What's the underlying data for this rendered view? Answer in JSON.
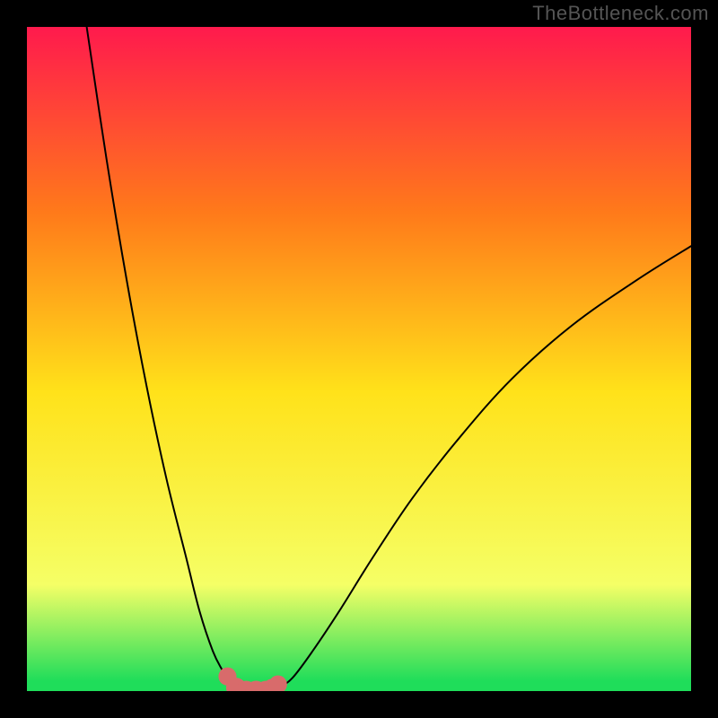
{
  "watermark": "TheBottleneck.com",
  "colors": {
    "bg": "#000000",
    "grad_top": "#ff1a4d",
    "grad_mid1": "#ff7a1a",
    "grad_mid2": "#ffe21a",
    "grad_mid3": "#f5ff66",
    "grad_bottom": "#1fdd5a",
    "curve": "#000000",
    "marker_fill": "#d86b6b",
    "marker_stroke": "#c74f4f"
  },
  "chart_data": {
    "type": "line",
    "title": "",
    "xlabel": "",
    "ylabel": "",
    "xlim": [
      0,
      100
    ],
    "ylim": [
      0,
      100
    ],
    "series": [
      {
        "name": "left-branch",
        "x": [
          9,
          12,
          15,
          18,
          21,
          24,
          26,
          28,
          29.5,
          30.5,
          31.3,
          32
        ],
        "y": [
          100,
          80,
          62,
          46,
          32,
          20,
          12,
          6,
          3,
          1.2,
          0.3,
          0
        ]
      },
      {
        "name": "right-branch",
        "x": [
          37,
          38,
          40,
          43,
          47,
          52,
          58,
          65,
          73,
          82,
          92,
          100
        ],
        "y": [
          0,
          0.5,
          2,
          6,
          12,
          20,
          29,
          38,
          47,
          55,
          62,
          67
        ]
      },
      {
        "name": "valley-floor",
        "x": [
          32,
          33.5,
          35,
          36,
          37
        ],
        "y": [
          0,
          0,
          0,
          0,
          0
        ]
      }
    ],
    "markers": {
      "name": "highlight-points",
      "x": [
        30.2,
        31.5,
        33,
        34.5,
        36,
        37,
        37.8
      ],
      "y": [
        2.2,
        0.5,
        0,
        0,
        0,
        0.3,
        1.0
      ],
      "r": [
        1.1,
        1.4,
        1.5,
        1.5,
        1.5,
        1.5,
        1.1
      ]
    },
    "gradient_stops": [
      {
        "offset": 0.0,
        "key": "grad_top"
      },
      {
        "offset": 0.28,
        "key": "grad_mid1"
      },
      {
        "offset": 0.55,
        "key": "grad_mid2"
      },
      {
        "offset": 0.84,
        "key": "grad_mid3"
      },
      {
        "offset": 0.985,
        "key": "grad_bottom"
      }
    ]
  }
}
